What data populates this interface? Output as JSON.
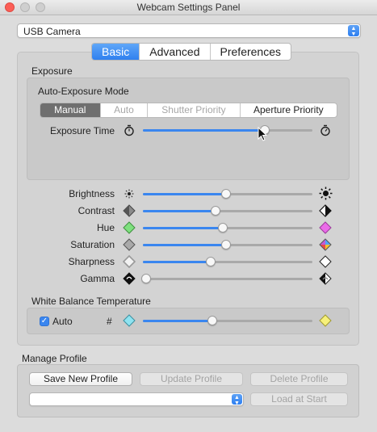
{
  "window": {
    "title": "Webcam Settings Panel"
  },
  "device": {
    "selected": "USB Camera"
  },
  "tabs": [
    {
      "label": "Basic",
      "active": true
    },
    {
      "label": "Advanced",
      "active": false
    },
    {
      "label": "Preferences",
      "active": false
    }
  ],
  "exposure": {
    "heading": "Exposure",
    "mode_label": "Auto-Exposure Mode",
    "modes": [
      {
        "label": "Manual",
        "state": "selected"
      },
      {
        "label": "Auto",
        "state": "disabled"
      },
      {
        "label": "Shutter Priority",
        "state": "disabled"
      },
      {
        "label": "Aperture Priority",
        "state": "enabled"
      }
    ],
    "time_label": "Exposure Time",
    "time_level": 0.72
  },
  "sliders": [
    {
      "label": "Brightness",
      "level": 0.49
    },
    {
      "label": "Contrast",
      "level": 0.43
    },
    {
      "label": "Hue",
      "level": 0.47
    },
    {
      "label": "Saturation",
      "level": 0.49
    },
    {
      "label": "Sharpness",
      "level": 0.4
    },
    {
      "label": "Gamma",
      "level": 0.02
    }
  ],
  "white_balance": {
    "heading": "White Balance Temperature",
    "auto_label": "Auto",
    "auto_checked": true,
    "hash": "#",
    "level": 0.41
  },
  "profile": {
    "heading": "Manage Profile",
    "save_label": "Save New Profile",
    "update_label": "Update Profile",
    "delete_label": "Delete Profile",
    "load_label": "Load at Start",
    "selected": ""
  },
  "colors": {
    "accent": "#3a86ef",
    "close": "#fc5f57"
  }
}
